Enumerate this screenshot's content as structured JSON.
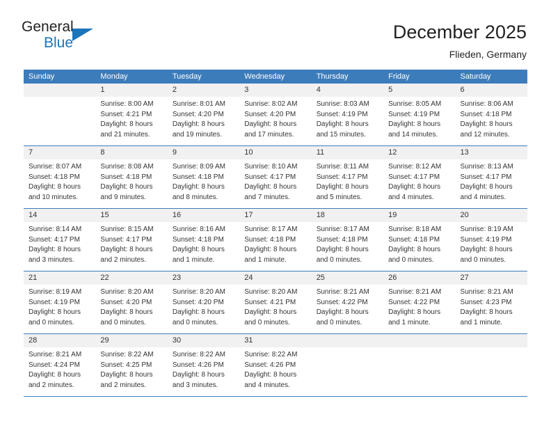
{
  "brand": {
    "name_top": "General",
    "name_bottom": "Blue",
    "accent_color": "#1b75bb"
  },
  "header": {
    "month_title": "December 2025",
    "location": "Flieden, Germany"
  },
  "theme": {
    "header_row_bg": "#3d7cba",
    "day_band_bg": "#f1f1f1",
    "text_color": "#333333"
  },
  "calendar": {
    "weekdays": [
      "Sunday",
      "Monday",
      "Tuesday",
      "Wednesday",
      "Thursday",
      "Friday",
      "Saturday"
    ],
    "weeks": [
      [
        {
          "day": "",
          "lines": []
        },
        {
          "day": "1",
          "lines": [
            "Sunrise: 8:00 AM",
            "Sunset: 4:21 PM",
            "Daylight: 8 hours",
            "and 21 minutes."
          ]
        },
        {
          "day": "2",
          "lines": [
            "Sunrise: 8:01 AM",
            "Sunset: 4:20 PM",
            "Daylight: 8 hours",
            "and 19 minutes."
          ]
        },
        {
          "day": "3",
          "lines": [
            "Sunrise: 8:02 AM",
            "Sunset: 4:20 PM",
            "Daylight: 8 hours",
            "and 17 minutes."
          ]
        },
        {
          "day": "4",
          "lines": [
            "Sunrise: 8:03 AM",
            "Sunset: 4:19 PM",
            "Daylight: 8 hours",
            "and 15 minutes."
          ]
        },
        {
          "day": "5",
          "lines": [
            "Sunrise: 8:05 AM",
            "Sunset: 4:19 PM",
            "Daylight: 8 hours",
            "and 14 minutes."
          ]
        },
        {
          "day": "6",
          "lines": [
            "Sunrise: 8:06 AM",
            "Sunset: 4:18 PM",
            "Daylight: 8 hours",
            "and 12 minutes."
          ]
        }
      ],
      [
        {
          "day": "7",
          "lines": [
            "Sunrise: 8:07 AM",
            "Sunset: 4:18 PM",
            "Daylight: 8 hours",
            "and 10 minutes."
          ]
        },
        {
          "day": "8",
          "lines": [
            "Sunrise: 8:08 AM",
            "Sunset: 4:18 PM",
            "Daylight: 8 hours",
            "and 9 minutes."
          ]
        },
        {
          "day": "9",
          "lines": [
            "Sunrise: 8:09 AM",
            "Sunset: 4:18 PM",
            "Daylight: 8 hours",
            "and 8 minutes."
          ]
        },
        {
          "day": "10",
          "lines": [
            "Sunrise: 8:10 AM",
            "Sunset: 4:17 PM",
            "Daylight: 8 hours",
            "and 7 minutes."
          ]
        },
        {
          "day": "11",
          "lines": [
            "Sunrise: 8:11 AM",
            "Sunset: 4:17 PM",
            "Daylight: 8 hours",
            "and 5 minutes."
          ]
        },
        {
          "day": "12",
          "lines": [
            "Sunrise: 8:12 AM",
            "Sunset: 4:17 PM",
            "Daylight: 8 hours",
            "and 4 minutes."
          ]
        },
        {
          "day": "13",
          "lines": [
            "Sunrise: 8:13 AM",
            "Sunset: 4:17 PM",
            "Daylight: 8 hours",
            "and 4 minutes."
          ]
        }
      ],
      [
        {
          "day": "14",
          "lines": [
            "Sunrise: 8:14 AM",
            "Sunset: 4:17 PM",
            "Daylight: 8 hours",
            "and 3 minutes."
          ]
        },
        {
          "day": "15",
          "lines": [
            "Sunrise: 8:15 AM",
            "Sunset: 4:17 PM",
            "Daylight: 8 hours",
            "and 2 minutes."
          ]
        },
        {
          "day": "16",
          "lines": [
            "Sunrise: 8:16 AM",
            "Sunset: 4:18 PM",
            "Daylight: 8 hours",
            "and 1 minute."
          ]
        },
        {
          "day": "17",
          "lines": [
            "Sunrise: 8:17 AM",
            "Sunset: 4:18 PM",
            "Daylight: 8 hours",
            "and 1 minute."
          ]
        },
        {
          "day": "18",
          "lines": [
            "Sunrise: 8:17 AM",
            "Sunset: 4:18 PM",
            "Daylight: 8 hours",
            "and 0 minutes."
          ]
        },
        {
          "day": "19",
          "lines": [
            "Sunrise: 8:18 AM",
            "Sunset: 4:18 PM",
            "Daylight: 8 hours",
            "and 0 minutes."
          ]
        },
        {
          "day": "20",
          "lines": [
            "Sunrise: 8:19 AM",
            "Sunset: 4:19 PM",
            "Daylight: 8 hours",
            "and 0 minutes."
          ]
        }
      ],
      [
        {
          "day": "21",
          "lines": [
            "Sunrise: 8:19 AM",
            "Sunset: 4:19 PM",
            "Daylight: 8 hours",
            "and 0 minutes."
          ]
        },
        {
          "day": "22",
          "lines": [
            "Sunrise: 8:20 AM",
            "Sunset: 4:20 PM",
            "Daylight: 8 hours",
            "and 0 minutes."
          ]
        },
        {
          "day": "23",
          "lines": [
            "Sunrise: 8:20 AM",
            "Sunset: 4:20 PM",
            "Daylight: 8 hours",
            "and 0 minutes."
          ]
        },
        {
          "day": "24",
          "lines": [
            "Sunrise: 8:20 AM",
            "Sunset: 4:21 PM",
            "Daylight: 8 hours",
            "and 0 minutes."
          ]
        },
        {
          "day": "25",
          "lines": [
            "Sunrise: 8:21 AM",
            "Sunset: 4:22 PM",
            "Daylight: 8 hours",
            "and 0 minutes."
          ]
        },
        {
          "day": "26",
          "lines": [
            "Sunrise: 8:21 AM",
            "Sunset: 4:22 PM",
            "Daylight: 8 hours",
            "and 1 minute."
          ]
        },
        {
          "day": "27",
          "lines": [
            "Sunrise: 8:21 AM",
            "Sunset: 4:23 PM",
            "Daylight: 8 hours",
            "and 1 minute."
          ]
        }
      ],
      [
        {
          "day": "28",
          "lines": [
            "Sunrise: 8:21 AM",
            "Sunset: 4:24 PM",
            "Daylight: 8 hours",
            "and 2 minutes."
          ]
        },
        {
          "day": "29",
          "lines": [
            "Sunrise: 8:22 AM",
            "Sunset: 4:25 PM",
            "Daylight: 8 hours",
            "and 2 minutes."
          ]
        },
        {
          "day": "30",
          "lines": [
            "Sunrise: 8:22 AM",
            "Sunset: 4:26 PM",
            "Daylight: 8 hours",
            "and 3 minutes."
          ]
        },
        {
          "day": "31",
          "lines": [
            "Sunrise: 8:22 AM",
            "Sunset: 4:26 PM",
            "Daylight: 8 hours",
            "and 4 minutes."
          ]
        },
        {
          "day": "",
          "lines": []
        },
        {
          "day": "",
          "lines": []
        },
        {
          "day": "",
          "lines": []
        }
      ]
    ]
  }
}
